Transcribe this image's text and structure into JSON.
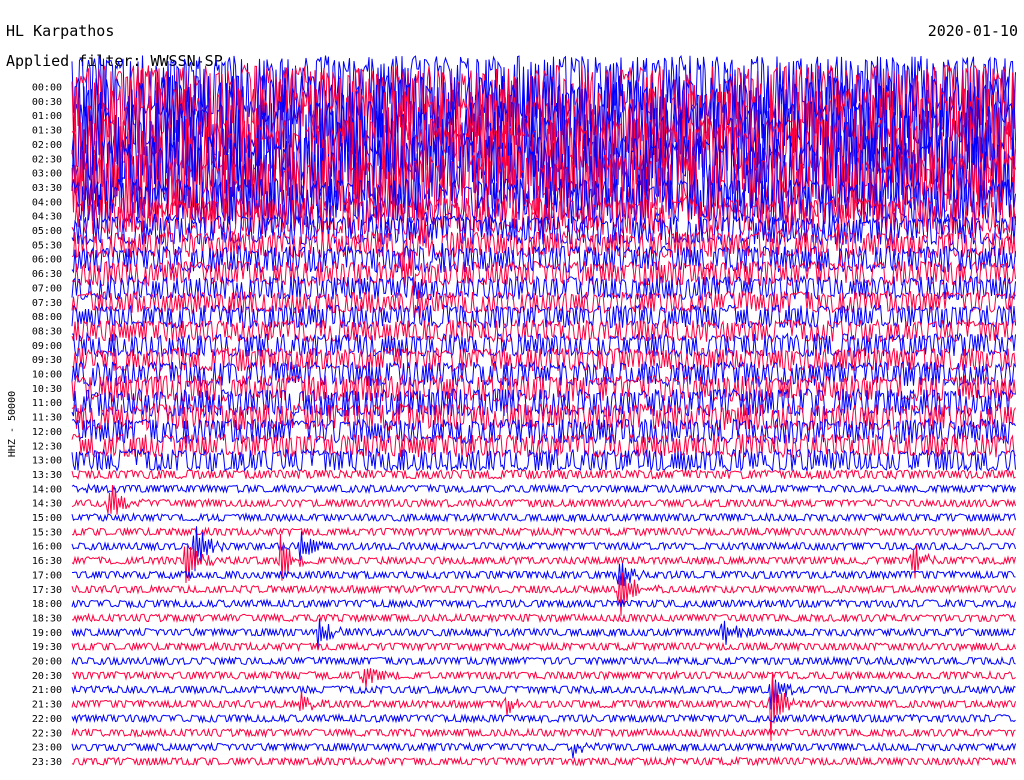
{
  "header": {
    "station": "HL Karpathos",
    "date": "2020-01-10",
    "filter_label": "Applied filter: WWSSN-SP"
  },
  "chart_data": {
    "type": "line",
    "title": "HL Karpathos",
    "xlabel": "",
    "ylabel": "HHZ - 50000",
    "grid": false,
    "line_interval_minutes": 30,
    "trace_colors": [
      "#0000ff",
      "#ff0040"
    ],
    "y_tick_labels": [
      "00:00",
      "00:30",
      "01:00",
      "01:30",
      "02:00",
      "02:30",
      "03:00",
      "03:30",
      "04:00",
      "04:30",
      "05:00",
      "05:30",
      "06:00",
      "06:30",
      "07:00",
      "07:30",
      "08:00",
      "08:30",
      "09:00",
      "09:30",
      "10:00",
      "10:30",
      "11:00",
      "11:30",
      "12:00",
      "12:30",
      "13:00",
      "13:30",
      "14:00",
      "14:30",
      "15:00",
      "15:30",
      "16:00",
      "16:30",
      "17:00",
      "17:30",
      "18:00",
      "18:30",
      "19:00",
      "19:30",
      "20:00",
      "20:30",
      "21:00",
      "21:30",
      "22:00",
      "22:30",
      "23:00",
      "23:30"
    ],
    "noise_level": [
      2.2,
      2.5,
      2.8,
      2.9,
      3.0,
      2.8,
      2.6,
      2.3,
      1.6,
      1.3,
      1.0,
      0.9,
      0.9,
      0.85,
      0.8,
      0.75,
      0.8,
      0.75,
      0.8,
      0.8,
      0.85,
      0.9,
      0.95,
      0.9,
      0.85,
      0.8,
      0.75,
      0.3,
      0.25,
      0.25,
      0.25,
      0.25,
      0.25,
      0.25,
      0.25,
      0.25,
      0.25,
      0.25,
      0.25,
      0.25,
      0.25,
      0.25,
      0.25,
      0.25,
      0.25,
      0.25,
      0.25,
      0.25
    ],
    "events": [
      {
        "line": 9,
        "t": 0.1,
        "amp": 14
      },
      {
        "line": 10,
        "t": 0.08,
        "amp": 10
      },
      {
        "line": 11,
        "t": 0.37,
        "amp": 20
      },
      {
        "line": 12,
        "t": 0.38,
        "amp": 18
      },
      {
        "line": 11,
        "t": 0.81,
        "amp": 18
      },
      {
        "line": 13,
        "t": 0.35,
        "amp": 40
      },
      {
        "line": 15,
        "t": 0.36,
        "amp": 14
      },
      {
        "line": 28,
        "t": 0.01,
        "amp": 6
      },
      {
        "line": 29,
        "t": 0.04,
        "amp": 22
      },
      {
        "line": 32,
        "t": 0.13,
        "amp": 30
      },
      {
        "line": 32,
        "t": 0.24,
        "amp": 20
      },
      {
        "line": 33,
        "t": 0.12,
        "amp": 34
      },
      {
        "line": 33,
        "t": 0.22,
        "amp": 28
      },
      {
        "line": 33,
        "t": 0.89,
        "amp": 22
      },
      {
        "line": 34,
        "t": 0.58,
        "amp": 20
      },
      {
        "line": 35,
        "t": 0.58,
        "amp": 34
      },
      {
        "line": 38,
        "t": 0.26,
        "amp": 20
      },
      {
        "line": 38,
        "t": 0.69,
        "amp": 16
      },
      {
        "line": 41,
        "t": 0.31,
        "amp": 12
      },
      {
        "line": 42,
        "t": 0.74,
        "amp": 26
      },
      {
        "line": 43,
        "t": 0.24,
        "amp": 14
      },
      {
        "line": 43,
        "t": 0.46,
        "amp": 10
      },
      {
        "line": 43,
        "t": 0.74,
        "amp": 38
      },
      {
        "line": 46,
        "t": 0.53,
        "amp": 10
      }
    ]
  }
}
